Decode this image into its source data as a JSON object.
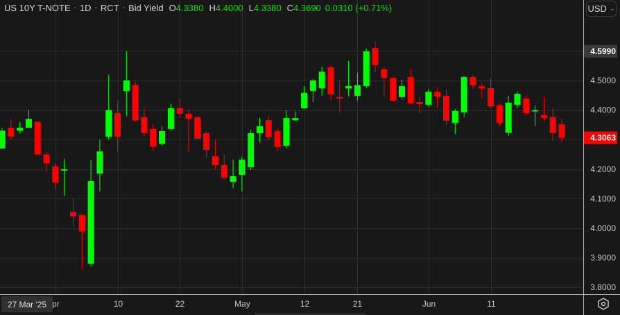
{
  "header": {
    "symbol": "US 10Y T-NOTE",
    "interval": "1D",
    "source": "RCT",
    "price_type": "Bid Yield",
    "open_label": "O",
    "open": "4.3380",
    "high_label": "H",
    "high": "4.4000",
    "low_label": "L",
    "low": "4.3380",
    "close_label": "C",
    "close": "4.3690",
    "change": "0.0310 (+0.71%)"
  },
  "currency_button": {
    "label": "USD",
    "icon": "chevron-down-icon"
  },
  "crosshair_date": "27 Mar '25",
  "settings_icon": "settings-hexagon-icon",
  "colors": {
    "up": "#00ff00",
    "down": "#ff0000",
    "background": "#181818",
    "grid": "#2c2c2c",
    "last_price_bg": "#ff0000",
    "high_label_bg": "#3a3a3a"
  },
  "chart_data": {
    "type": "candlestick",
    "title": "US 10Y T-NOTE · 1D · RCT · Bid Yield",
    "ylim": [
      3.78,
      4.66
    ],
    "y_ticks": [
      "4.5000",
      "4.4000",
      "4.2000",
      "4.1000",
      "4.0000",
      "3.9000",
      "3.8000"
    ],
    "highlight_labels": {
      "high": "4.5990",
      "last": "4.3063"
    },
    "x_tick_labels": [
      {
        "label": "pr",
        "index": 6
      },
      {
        "label": "10",
        "index": 13
      },
      {
        "label": "22",
        "index": 20
      },
      {
        "label": "May",
        "index": 27
      },
      {
        "label": "12",
        "index": 34
      },
      {
        "label": "21",
        "index": 40
      },
      {
        "label": "Jun",
        "index": 48
      },
      {
        "label": "11",
        "index": 55
      }
    ],
    "candles": [
      [
        4.27,
        4.34,
        4.27,
        4.33
      ],
      [
        4.34,
        4.37,
        4.3,
        4.31
      ],
      [
        4.33,
        4.36,
        4.32,
        4.34
      ],
      [
        4.34,
        4.4,
        4.34,
        4.37
      ],
      [
        4.36,
        4.36,
        4.25,
        4.25
      ],
      [
        4.25,
        4.26,
        4.19,
        4.22
      ],
      [
        4.21,
        4.22,
        4.135,
        4.155
      ],
      [
        4.195,
        4.235,
        4.11,
        4.2
      ],
      [
        4.055,
        4.1,
        4.005,
        4.04
      ],
      [
        4.045,
        4.05,
        3.86,
        3.99
      ],
      [
        3.88,
        4.23,
        3.87,
        4.16
      ],
      [
        4.185,
        4.3,
        4.125,
        4.26
      ],
      [
        4.31,
        4.52,
        4.3,
        4.4
      ],
      [
        4.39,
        4.43,
        4.26,
        4.31
      ],
      [
        4.465,
        4.6,
        4.38,
        4.5
      ],
      [
        4.485,
        4.5,
        4.36,
        4.365
      ],
      [
        4.376,
        4.41,
        4.31,
        4.322
      ],
      [
        4.336,
        4.352,
        4.263,
        4.277
      ],
      [
        4.286,
        4.345,
        4.279,
        4.329
      ],
      [
        4.336,
        4.422,
        4.331,
        4.406
      ],
      [
        4.406,
        4.439,
        4.373,
        4.387
      ],
      [
        4.387,
        4.401,
        4.26,
        4.371
      ],
      [
        4.376,
        4.376,
        4.303,
        4.303
      ],
      [
        4.322,
        4.331,
        4.237,
        4.265
      ],
      [
        4.244,
        4.298,
        4.202,
        4.214
      ],
      [
        4.214,
        4.249,
        4.164,
        4.171
      ],
      [
        4.157,
        4.232,
        4.136,
        4.176
      ],
      [
        4.181,
        4.242,
        4.124,
        4.232
      ],
      [
        4.207,
        4.333,
        4.197,
        4.322
      ],
      [
        4.322,
        4.373,
        4.291,
        4.345
      ],
      [
        4.366,
        4.38,
        4.298,
        4.308
      ],
      [
        4.329,
        4.336,
        4.261,
        4.275
      ],
      [
        4.279,
        4.399,
        4.27,
        4.373
      ],
      [
        4.366,
        4.395,
        4.364,
        4.373
      ],
      [
        4.406,
        4.481,
        4.404,
        4.458
      ],
      [
        4.465,
        4.505,
        4.427,
        4.5
      ],
      [
        4.474,
        4.547,
        4.448,
        4.53
      ],
      [
        4.545,
        4.552,
        4.432,
        4.453
      ],
      [
        4.444,
        4.5,
        4.39,
        4.439
      ],
      [
        4.474,
        4.566,
        4.446,
        4.481
      ],
      [
        4.448,
        4.526,
        4.432,
        4.484
      ],
      [
        4.481,
        4.608,
        4.474,
        4.599
      ],
      [
        4.61,
        4.631,
        4.528,
        4.552
      ],
      [
        4.538,
        4.545,
        4.448,
        4.509
      ],
      [
        4.509,
        4.51,
        4.43,
        4.432
      ],
      [
        4.444,
        4.502,
        4.439,
        4.481
      ],
      [
        4.512,
        4.54,
        4.42,
        4.423
      ],
      [
        4.427,
        4.444,
        4.387,
        4.42
      ],
      [
        4.418,
        4.472,
        4.411,
        4.462
      ],
      [
        4.462,
        4.477,
        4.408,
        4.446
      ],
      [
        4.448,
        4.47,
        4.35,
        4.364
      ],
      [
        4.357,
        4.404,
        4.319,
        4.397
      ],
      [
        4.392,
        4.516,
        4.376,
        4.512
      ],
      [
        4.512,
        4.519,
        4.472,
        4.484
      ],
      [
        4.481,
        4.491,
        4.439,
        4.474
      ],
      [
        4.474,
        4.507,
        4.406,
        4.413
      ],
      [
        4.416,
        4.423,
        4.345,
        4.357
      ],
      [
        4.324,
        4.448,
        4.312,
        4.425
      ],
      [
        4.418,
        4.462,
        4.406,
        4.455
      ],
      [
        4.439,
        4.448,
        4.383,
        4.39
      ],
      [
        4.399,
        4.416,
        4.345,
        4.4
      ],
      [
        4.383,
        4.444,
        4.362,
        4.373
      ],
      [
        4.376,
        4.408,
        4.293,
        4.322
      ],
      [
        4.352,
        4.371,
        4.291,
        4.3063
      ]
    ]
  }
}
